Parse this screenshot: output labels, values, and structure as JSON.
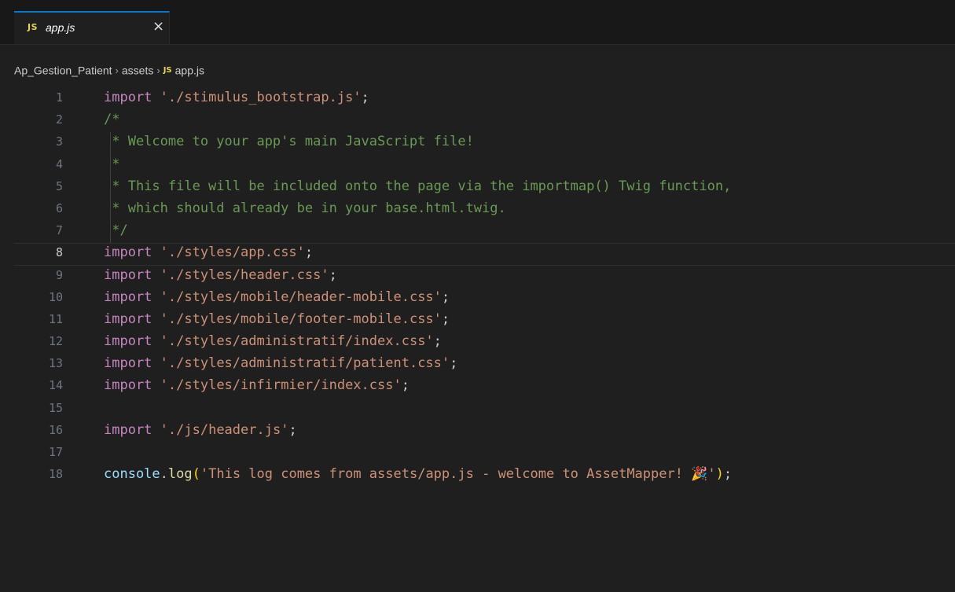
{
  "tab": {
    "badge": "JS",
    "label": "app.js",
    "close": "×"
  },
  "breadcrumb": {
    "project": "Ap_Gestion_Patient",
    "sep": "›",
    "folder": "assets",
    "file_badge": "JS",
    "file": "app.js"
  },
  "lines": [
    {
      "n": "1",
      "kind": "import",
      "kw": "import",
      "str": "'./stimulus_bootstrap.js'",
      "end": ";"
    },
    {
      "n": "2",
      "kind": "comment",
      "text": "/*"
    },
    {
      "n": "3",
      "kind": "comment",
      "text": " * Welcome to your app's main JavaScript file!"
    },
    {
      "n": "4",
      "kind": "comment",
      "text": " *"
    },
    {
      "n": "5",
      "kind": "comment",
      "text": " * This file will be included onto the page via the importmap() Twig function,"
    },
    {
      "n": "6",
      "kind": "comment",
      "text": " * which should already be in your base.html.twig."
    },
    {
      "n": "7",
      "kind": "comment",
      "text": " */"
    },
    {
      "n": "8",
      "kind": "import",
      "kw": "import",
      "str": "'./styles/app.css'",
      "end": ";"
    },
    {
      "n": "9",
      "kind": "import",
      "kw": "import",
      "str": "'./styles/header.css'",
      "end": ";"
    },
    {
      "n": "10",
      "kind": "import",
      "kw": "import",
      "str": "'./styles/mobile/header-mobile.css'",
      "end": ";"
    },
    {
      "n": "11",
      "kind": "import",
      "kw": "import",
      "str": "'./styles/mobile/footer-mobile.css'",
      "end": ";"
    },
    {
      "n": "12",
      "kind": "import",
      "kw": "import",
      "str": "'./styles/administratif/index.css'",
      "end": ";"
    },
    {
      "n": "13",
      "kind": "import",
      "kw": "import",
      "str": "'./styles/administratif/patient.css'",
      "end": ";"
    },
    {
      "n": "14",
      "kind": "import",
      "kw": "import",
      "str": "'./styles/infirmier/index.css'",
      "end": ";"
    },
    {
      "n": "15",
      "kind": "empty"
    },
    {
      "n": "16",
      "kind": "import",
      "kw": "import",
      "str": "'./js/header.js'",
      "end": ";"
    },
    {
      "n": "17",
      "kind": "empty"
    },
    {
      "n": "18",
      "kind": "log",
      "obj": "console",
      "dot": ".",
      "fn": "log",
      "open": "(",
      "str": "'This log comes from assets/app.js - welcome to AssetMapper! 🎉'",
      "close": ")",
      "end": ";"
    }
  ],
  "editor": {
    "active_line": "8"
  }
}
